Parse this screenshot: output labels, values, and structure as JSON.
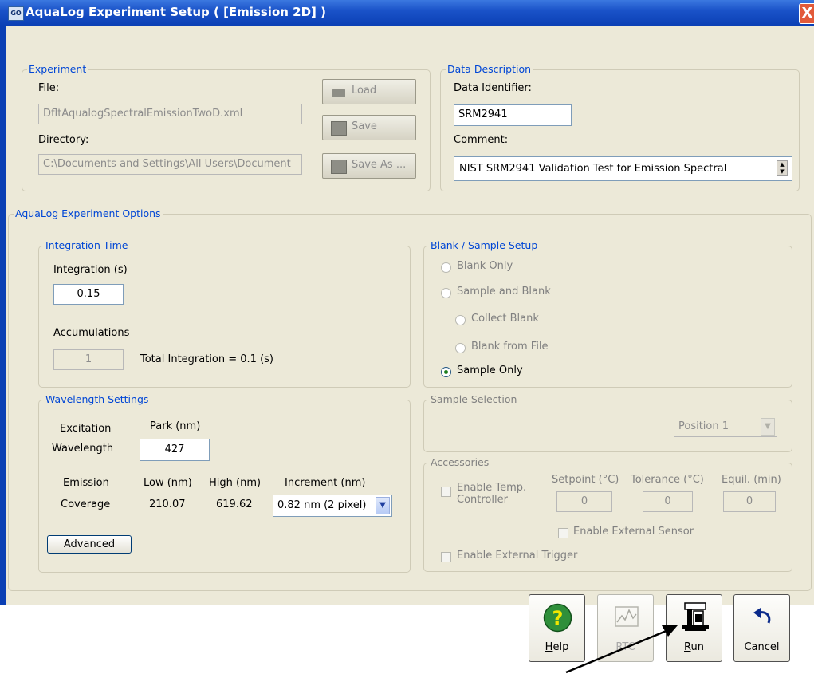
{
  "window": {
    "title": "AquaLog Experiment Setup ( [Emission 2D] )",
    "close_glyph": "X"
  },
  "experiment": {
    "legend": "Experiment",
    "file_label": "File:",
    "file_value": "DfltAqualogSpectralEmissionTwoD.xml",
    "directory_label": "Directory:",
    "directory_value": "C:\\Documents and Settings\\All Users\\Document",
    "load_label": "Load",
    "save_label": "Save",
    "save_as_label": "Save As ..."
  },
  "data_description": {
    "legend": "Data Description",
    "identifier_label": "Data Identifier:",
    "identifier_value": "SRM2941",
    "comment_label": "Comment:",
    "comment_value": "NIST SRM2941 Validation Test for Emission Spectral"
  },
  "options": {
    "legend": "AquaLog Experiment Options",
    "integration": {
      "legend": "Integration Time",
      "integration_label": "Integration (s)",
      "integration_value": "0.15",
      "accumulations_label": "Accumulations",
      "accumulations_value": "1",
      "total_text": "Total Integration = 0.1 (s)"
    },
    "wavelength": {
      "legend": "Wavelength Settings",
      "excitation_label": "Excitation",
      "park_label": "Park (nm)",
      "wavelength_label": "Wavelength",
      "wavelength_value": "427",
      "emission_label": "Emission",
      "low_label": "Low (nm)",
      "high_label": "High (nm)",
      "increment_label": "Increment (nm)",
      "coverage_label": "Coverage",
      "low_value": "210.07",
      "high_value": "619.62",
      "increment_value": "0.82 nm (2 pixel)",
      "advanced_label": "Advanced"
    },
    "blank_sample": {
      "legend": "Blank / Sample Setup",
      "blank_only": "Blank Only",
      "sample_and_blank": "Sample and Blank",
      "collect_blank": "Collect Blank",
      "blank_from_file": "Blank from File",
      "sample_only": "Sample Only",
      "selected": "Sample Only"
    },
    "sample_selection": {
      "legend": "Sample Selection",
      "position_value": "Position 1"
    },
    "accessories": {
      "legend": "Accessories",
      "enable_temp_line1": "Enable Temp.",
      "enable_temp_line2": "Controller",
      "setpoint_label": "Setpoint (°C)",
      "tolerance_label": "Tolerance (°C)",
      "equil_label": "Equil. (min)",
      "setpoint_value": "0",
      "tolerance_value": "0",
      "equil_value": "0",
      "external_sensor_label": "Enable External Sensor",
      "external_trigger_label": "Enable External Trigger"
    }
  },
  "buttons": {
    "help_first": "H",
    "help_rest": "elp",
    "rtc_label": "RTC",
    "run_first": "R",
    "run_rest": "un",
    "cancel_label": "Cancel"
  },
  "icons": {
    "help": "help-icon",
    "rtc": "rtc-icon",
    "run": "run-icon",
    "cancel": "undo-arrow-icon",
    "annotation": "pointer-arrow"
  },
  "colors": {
    "title_bar": "#1a52c8",
    "group_legend_blue": "#0046d5",
    "dialog_face": "#ece9d8",
    "help_icon": "#2f8f3a"
  }
}
